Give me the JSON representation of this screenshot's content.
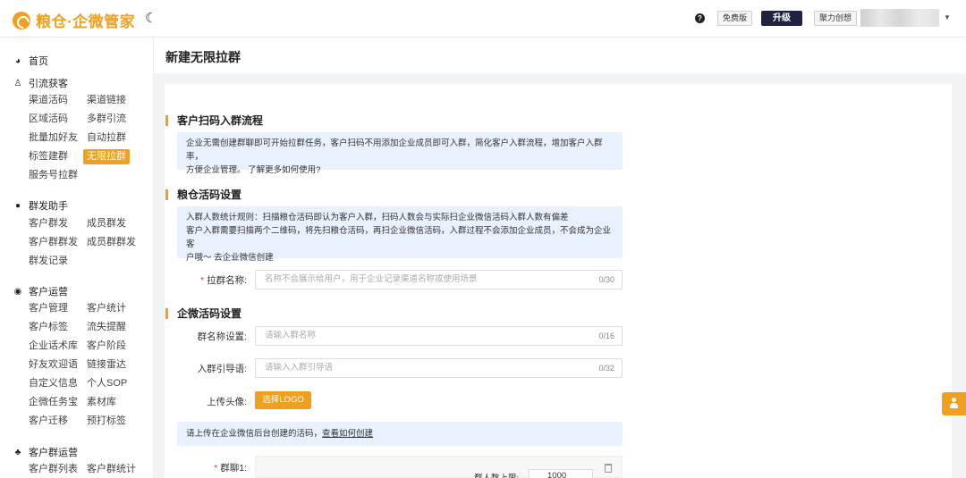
{
  "topbar": {
    "brand": "粮仓·企微管家",
    "free_tag": "免费版",
    "upgrade": "升级",
    "org": "聚力创想"
  },
  "sidebar": {
    "groups": [
      {
        "title": "首页",
        "icon": "dashboard-icon"
      },
      {
        "title": "引流获客",
        "icon": "user-icon",
        "items": [
          "渠道活码",
          "渠道链接",
          "区域活码",
          "多群引流",
          "批量加好友",
          "自动拉群",
          "标签建群",
          "无限拉群",
          "服务号拉群"
        ]
      },
      {
        "title": "群发助手",
        "icon": "chat-icon",
        "items": [
          "客户群发",
          "成员群发",
          "客户群群发",
          "成员群群发",
          "群发记录"
        ]
      },
      {
        "title": "客户运营",
        "icon": "eye-icon",
        "items": [
          "客户管理",
          "客户统计",
          "客户标签",
          "流失提醒",
          "企业话术库",
          "客户阶段",
          "好友欢迎语",
          "链接雷达",
          "自定义信息",
          "个人SOP",
          "企微任务宝",
          "素材库",
          "客户迁移",
          "预打标签"
        ]
      },
      {
        "title": "客户群运营",
        "icon": "org-icon",
        "items": [
          "客户群列表",
          "客户群统计"
        ]
      }
    ],
    "active": "无限拉群"
  },
  "page": {
    "title": "新建无限拉群"
  },
  "section1": {
    "title": "客户扫码入群流程",
    "info_line1": "企业无需创建群聊即可开始拉群任务，客户扫码不用添加企业成员即可入群，简化客户入群流程，增加客户入群率，",
    "info_line2": "方便企业管理。",
    "info_link": "了解更多如何使用?"
  },
  "section2": {
    "title": "粮仓活码设置",
    "info_line1": "入群人数统计规则：扫描粮仓活码即认为客户入群，扫码人数会与实际扫企业微信活码入群人数有偏差",
    "info_line2": "客户入群需要扫描两个二维码，将先扫粮仓活码，再扫企业微信活码，入群过程不会添加企业成员，不会成为企业客",
    "info_line3": "户哦～",
    "info_link": "去企业微信创建",
    "name_label": "拉群名称:",
    "name_placeholder": "名称不会展示给用户，用于企业记录渠道名称或使用场景",
    "name_count": "0/30"
  },
  "section3": {
    "title": "企微活码设置",
    "group_name_label": "群名称设置:",
    "group_name_placeholder": "请输入群名称",
    "group_name_count": "0/16",
    "guide_label": "入群引导语:",
    "guide_placeholder": "请输入入群引导语",
    "guide_count": "0/32",
    "avatar_label": "上传头像:",
    "logo_button": "选择LOGO",
    "upload_tip": "请上传在企业微信后台创建的活码，",
    "upload_link": "查看如何创建",
    "group1_label": "群聊1:",
    "limit_label": "群人数上限:",
    "limit_value": "1000"
  }
}
